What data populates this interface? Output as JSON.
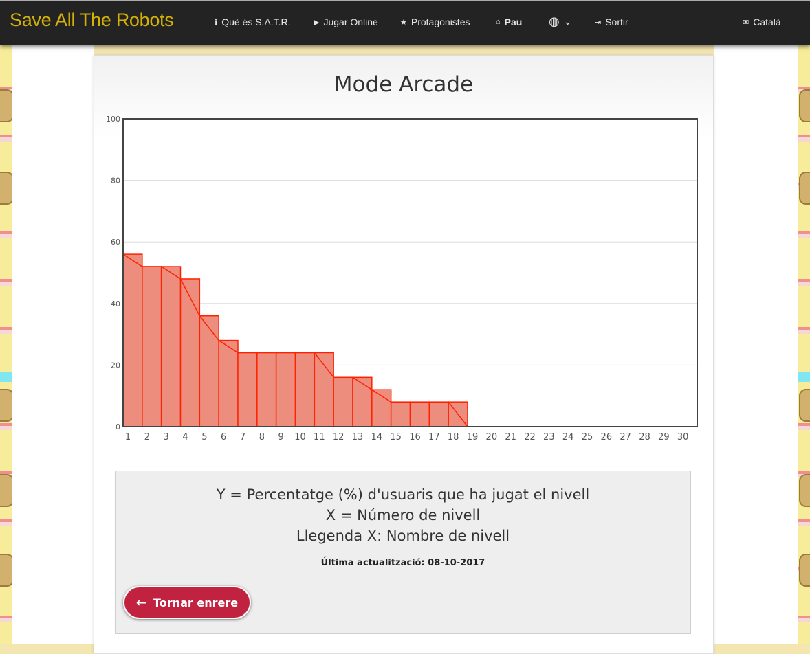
{
  "nav": {
    "brand": "Save All The Robots",
    "items": [
      {
        "icon": "info-icon",
        "glyph": "ℹ",
        "label": "Què és S.A.T.R."
      },
      {
        "icon": "play-icon",
        "glyph": "▶",
        "label": "Jugar Online"
      },
      {
        "icon": "star-icon",
        "glyph": "★",
        "label": "Protagonistes"
      },
      {
        "icon": "home-icon",
        "glyph": "⌂",
        "label": "Pau"
      },
      {
        "icon": "globe-icon",
        "glyph": "◍",
        "label": "⌄"
      },
      {
        "icon": "logout-icon",
        "glyph": "⇥",
        "label": "Sortir"
      },
      {
        "icon": "chat-icon",
        "glyph": "✉",
        "label": "Català"
      }
    ]
  },
  "page": {
    "title": "Mode Arcade"
  },
  "chart_data": {
    "type": "bar",
    "categories": [
      "1",
      "2",
      "3",
      "4",
      "5",
      "6",
      "7",
      "8",
      "9",
      "10",
      "11",
      "12",
      "13",
      "14",
      "15",
      "16",
      "17",
      "18",
      "19",
      "20",
      "21",
      "22",
      "23",
      "24",
      "25",
      "26",
      "27",
      "28",
      "29",
      "30"
    ],
    "values": [
      56,
      52,
      52,
      48,
      36,
      28,
      24,
      24,
      24,
      24,
      24,
      16,
      16,
      12,
      8,
      8,
      8,
      8,
      0,
      0,
      0,
      0,
      0,
      0,
      0,
      0,
      0,
      0,
      0,
      0
    ],
    "overlay": "area",
    "ylim": [
      0,
      100
    ],
    "yticks": [
      0,
      20,
      40,
      60,
      80,
      100
    ],
    "grid": true,
    "bar_color": "#ec8d7d",
    "line_color": "#ff2200",
    "area_color": "#cccccc"
  },
  "info": {
    "line1": "Y = Percentatge (%) d'usuaris que ha jugat el nivell",
    "line2": "X = Número de nivell",
    "line3": "Llegenda X: Nombre de nivell",
    "updated": "Última actualització: 08-10-2017",
    "back_label": "Tornar enrere"
  }
}
